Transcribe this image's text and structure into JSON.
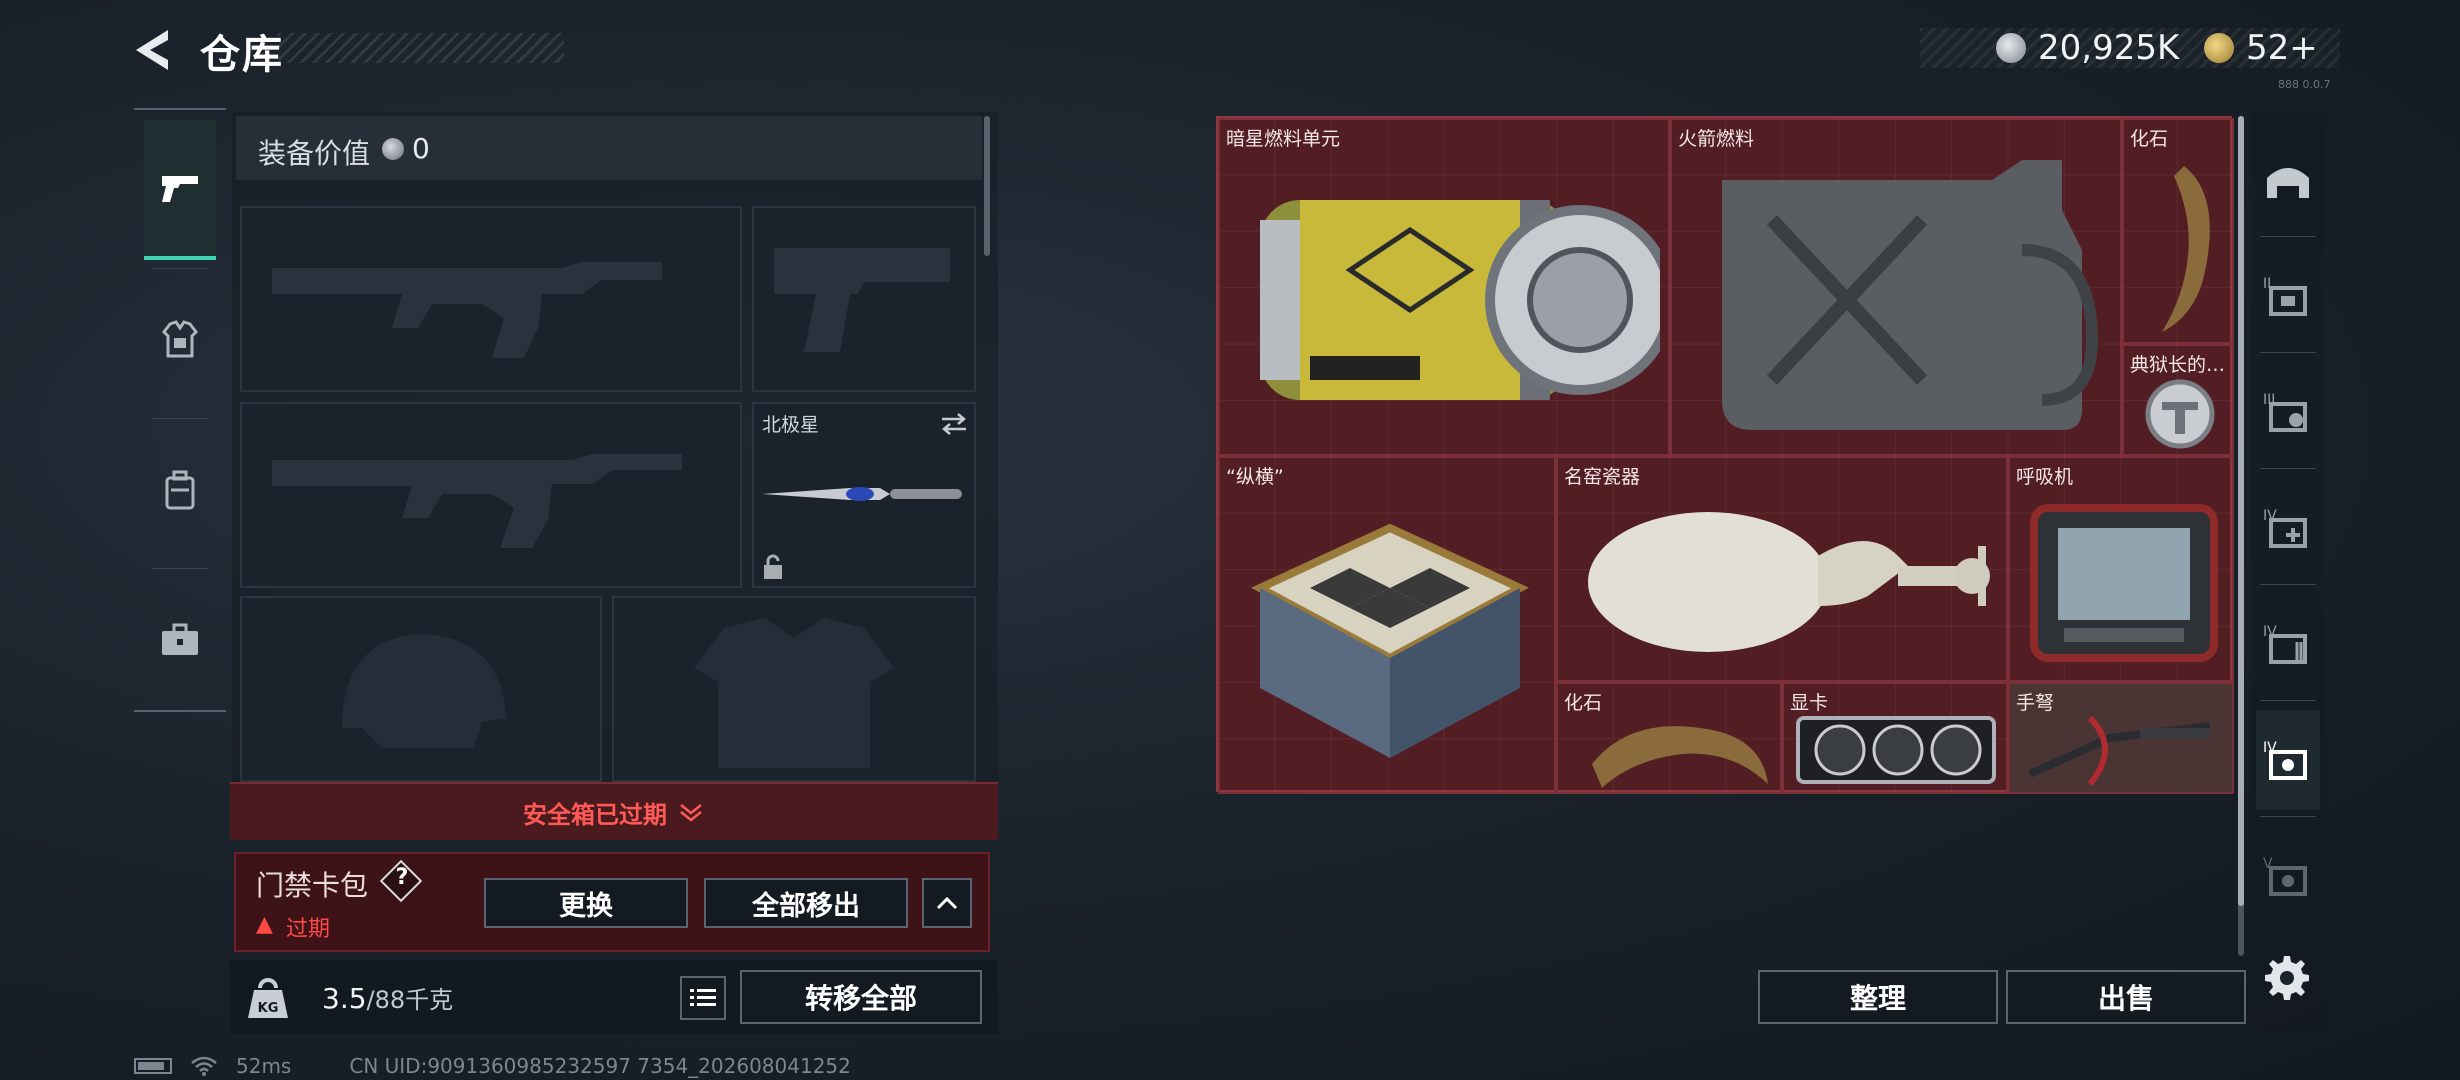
{
  "header": {
    "title": "仓库",
    "currency": {
      "silver": "20,925K",
      "gold": "52+"
    },
    "version": "888 0.0.7"
  },
  "equipment": {
    "value_label": "装备价值",
    "value": "0",
    "slots": {
      "melee_label": "北极星"
    }
  },
  "safe_box": {
    "status": "安全箱已过期"
  },
  "card_pack": {
    "name": "门禁卡包",
    "help": "?",
    "status": "过期",
    "replace": "更换",
    "remove_all": "全部移出"
  },
  "weight": {
    "current": "3.5",
    "max": "/88千克",
    "transfer_all": "转移全部"
  },
  "storage": {
    "items": [
      {
        "label": "暗星燃料单元"
      },
      {
        "label": "火箭燃料"
      },
      {
        "label": "化石"
      },
      {
        "label": "典狱长的…"
      },
      {
        "label": "“纵横”"
      },
      {
        "label": "名窑瓷器"
      },
      {
        "label": "呼吸机"
      },
      {
        "label": "化石"
      },
      {
        "label": "显卡"
      },
      {
        "label": "手弩"
      }
    ],
    "sort": "整理",
    "sell": "出售"
  },
  "footer": {
    "ping": "52ms",
    "uid": "CN UID:9091360985232597 7354_202608041252"
  },
  "colors": {
    "accent": "#41d6b0",
    "expired_red": "#ff4a44",
    "grid_bg": "#531e23"
  }
}
